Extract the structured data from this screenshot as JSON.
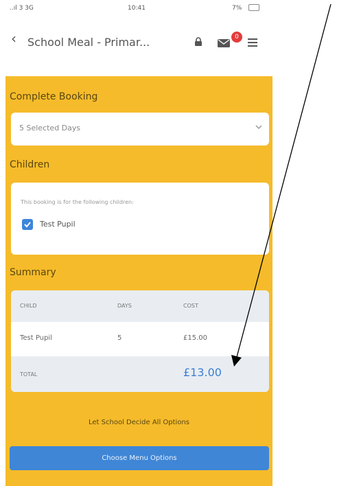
{
  "status_bar": {
    "signal": "..ıl 3 3G",
    "time": "10:41",
    "battery": "7%"
  },
  "header": {
    "back_icon": "chevron-left-icon",
    "title": "School Meal - Primar...",
    "badge_count": "0"
  },
  "booking": {
    "heading": "Complete Booking",
    "selected_days": "5 Selected Days"
  },
  "children": {
    "heading": "Children",
    "intro": "This booking is for the following children:",
    "items": [
      {
        "name": "Test Pupil",
        "checked": true
      }
    ]
  },
  "summary": {
    "heading": "Summary",
    "columns": [
      "CHILD",
      "DAYS",
      "COST"
    ],
    "rows": [
      {
        "child": "Test Pupil",
        "days": "5",
        "cost": "£15.00"
      }
    ],
    "total_label": "TOTAL",
    "total_value": "£13.00"
  },
  "actions": {
    "decide_label": "Let School Decide All Options",
    "choose_label": "Choose Menu Options"
  },
  "colors": {
    "background": "#f5bb2a",
    "button": "#3f86d6",
    "badge": "#e43b3b",
    "total": "#3a7fd4"
  }
}
